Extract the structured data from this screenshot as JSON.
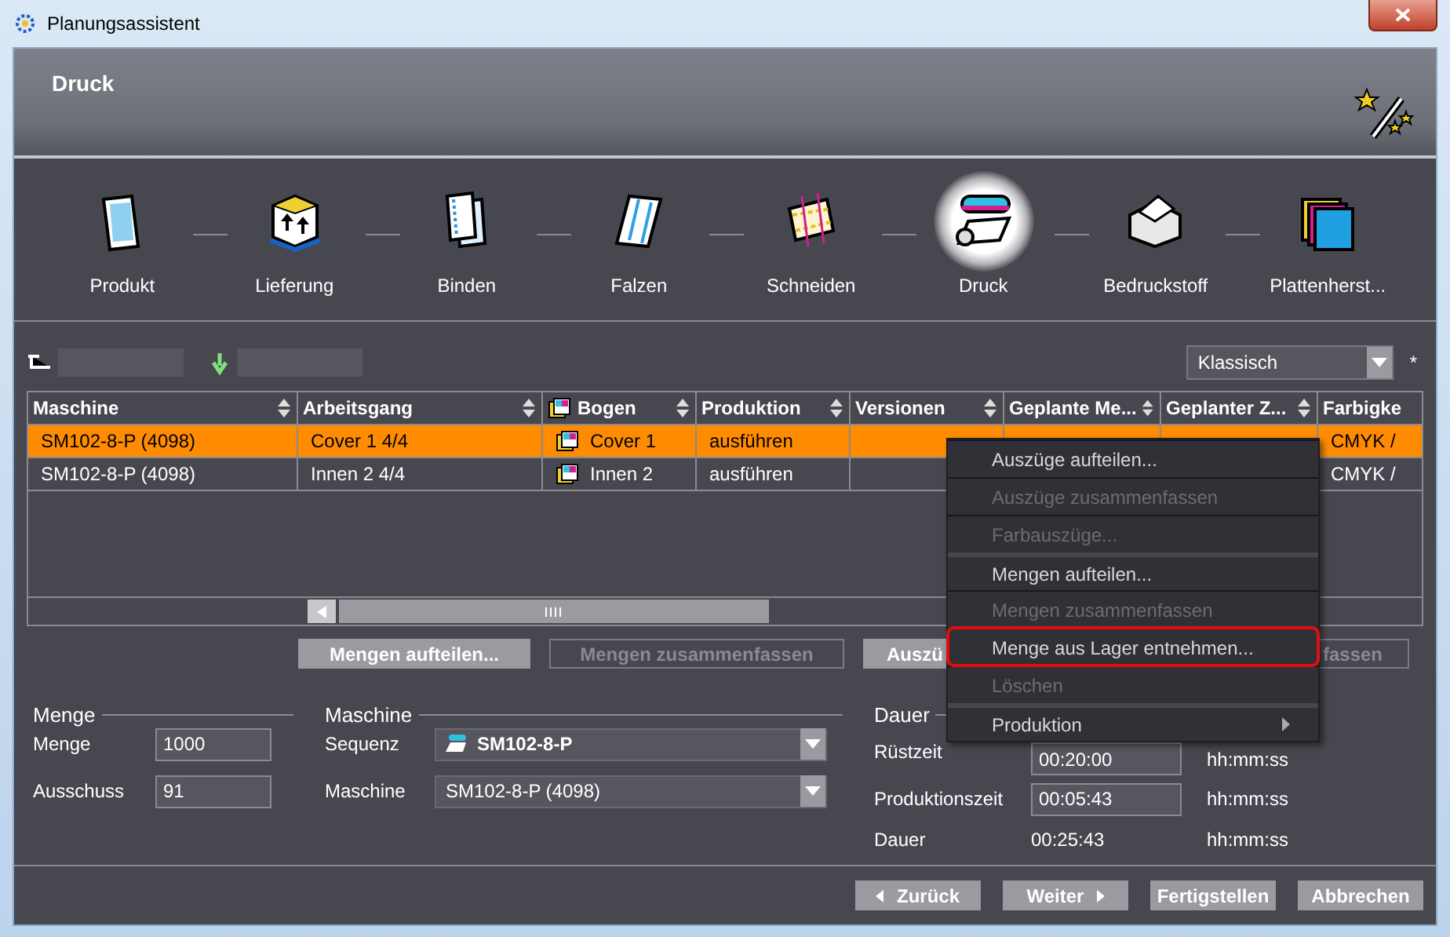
{
  "window": {
    "title": "Planungsassistent"
  },
  "header": {
    "title": "Druck"
  },
  "steps": [
    {
      "label": "Produkt",
      "kind": "product",
      "selected": false
    },
    {
      "label": "Lieferung",
      "kind": "box",
      "selected": false
    },
    {
      "label": "Binden",
      "kind": "binding",
      "selected": false
    },
    {
      "label": "Falzen",
      "kind": "fold",
      "selected": false
    },
    {
      "label": "Schneiden",
      "kind": "cut",
      "selected": false
    },
    {
      "label": "Druck",
      "kind": "print",
      "selected": true
    },
    {
      "label": "Bedruckstoff",
      "kind": "paper",
      "selected": false
    },
    {
      "label": "Plattenherst...",
      "kind": "plates",
      "selected": false
    }
  ],
  "view_select": {
    "value": "Klassisch",
    "mark": "*"
  },
  "table": {
    "columns": [
      {
        "label": "Maschine",
        "icon": false
      },
      {
        "label": "Arbeitsgang",
        "icon": false
      },
      {
        "label": "Bogen",
        "icon": true
      },
      {
        "label": "Produktion",
        "icon": false
      },
      {
        "label": "Versionen",
        "icon": false
      },
      {
        "label": "Geplante Me...",
        "icon": false
      },
      {
        "label": "Geplanter Z...",
        "icon": false
      },
      {
        "label": "Farbigke",
        "icon": false
      }
    ],
    "rows": [
      {
        "selected": true,
        "cells": [
          "SM102-8-P (4098)",
          "Cover 1 4/4",
          "Cover 1",
          "ausführen",
          "",
          "",
          "",
          "CMYK /"
        ]
      },
      {
        "selected": false,
        "cells": [
          "SM102-8-P (4098)",
          "Innen 2 4/4",
          "Innen 2",
          "ausführen",
          "",
          "",
          "",
          "CMYK /"
        ]
      }
    ]
  },
  "actions": [
    {
      "label": "Mengen aufteilen...",
      "disabled": false
    },
    {
      "label": "Mengen zusammenfassen",
      "disabled": true
    },
    {
      "label": "Auszü",
      "disabled": false
    },
    {
      "label": "fassen",
      "disabled": true
    }
  ],
  "context_menu": [
    {
      "label": "Auszüge aufteilen...",
      "disabled": false,
      "separator_before": false,
      "highlighted": false,
      "submenu": false
    },
    {
      "label": "Auszüge zusammenfassen",
      "disabled": true,
      "separator_before": false,
      "highlighted": false,
      "submenu": false
    },
    {
      "label": "Farbauszüge...",
      "disabled": true,
      "separator_before": false,
      "highlighted": false,
      "submenu": false
    },
    {
      "label": "Mengen aufteilen...",
      "disabled": false,
      "separator_before": true,
      "highlighted": false,
      "submenu": false
    },
    {
      "label": "Mengen zusammenfassen",
      "disabled": true,
      "separator_before": false,
      "highlighted": false,
      "submenu": false
    },
    {
      "label": "Menge aus Lager entnehmen...",
      "disabled": false,
      "separator_before": false,
      "highlighted": true,
      "submenu": false
    },
    {
      "label": "Löschen",
      "disabled": true,
      "separator_before": false,
      "highlighted": false,
      "submenu": false
    },
    {
      "label": "Produktion",
      "disabled": false,
      "separator_before": true,
      "highlighted": false,
      "submenu": true
    }
  ],
  "menge": {
    "title": "Menge",
    "fields": [
      {
        "label": "Menge",
        "value": "1000"
      },
      {
        "label": "Ausschuss",
        "value": "91"
      }
    ]
  },
  "maschine": {
    "title": "Maschine",
    "fields": [
      {
        "label": "Sequenz",
        "value": "SM102-8-P",
        "icon": true
      },
      {
        "label": "Maschine",
        "value": "SM102-8-P (4098)",
        "icon": false
      }
    ]
  },
  "dauer": {
    "title": "Dauer",
    "rows": [
      {
        "label": "Rüstzeit",
        "value": "00:20:00",
        "unit": "hh:mm:ss",
        "editable": true
      },
      {
        "label": "Produktionszeit",
        "value": "00:05:43",
        "unit": "hh:mm:ss",
        "editable": true
      },
      {
        "label": "Dauer",
        "value": "00:25:43",
        "unit": "hh:mm:ss",
        "editable": false
      }
    ]
  },
  "footer": [
    {
      "label": "Zurück",
      "kind": "back"
    },
    {
      "label": "Weiter",
      "kind": "next"
    },
    {
      "label": "Fertigstellen",
      "kind": "plain"
    },
    {
      "label": "Abbrechen",
      "kind": "plain"
    }
  ]
}
